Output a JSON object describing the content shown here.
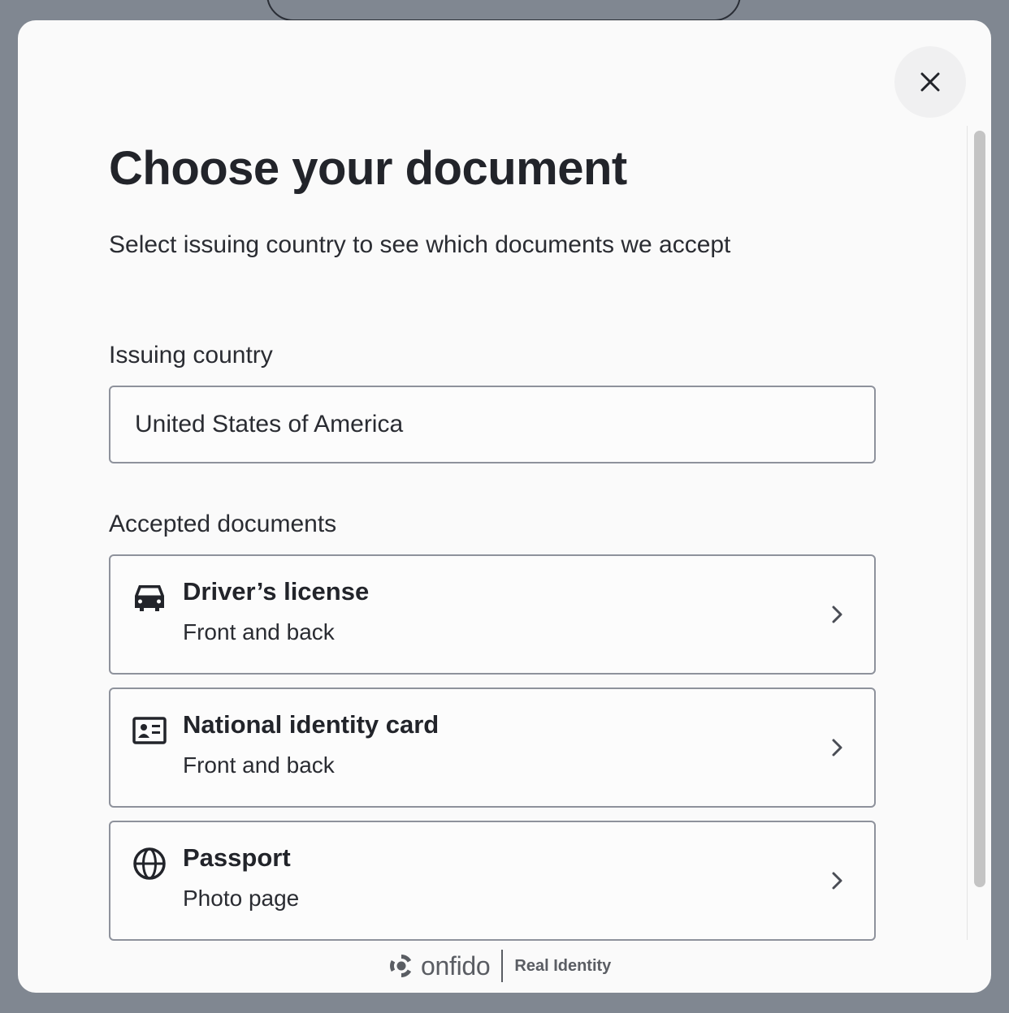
{
  "modal": {
    "title": "Choose your document",
    "subtitle": "Select issuing country to see which documents we accept",
    "close_icon": "close-icon"
  },
  "country": {
    "label": "Issuing country",
    "value": "United States of America"
  },
  "documents": {
    "label": "Accepted documents",
    "items": [
      {
        "title": "Driver’s license",
        "subtitle": "Front and back",
        "icon": "car-icon"
      },
      {
        "title": "National identity card",
        "subtitle": "Front and back",
        "icon": "id-card-icon"
      },
      {
        "title": "Passport",
        "subtitle": "Photo page",
        "icon": "globe-icon"
      }
    ]
  },
  "footer": {
    "brand": "onfido",
    "tagline": "Real Identity"
  },
  "colors": {
    "overlay": "#808791",
    "text_primary": "#22242a",
    "border": "#8e929c"
  }
}
